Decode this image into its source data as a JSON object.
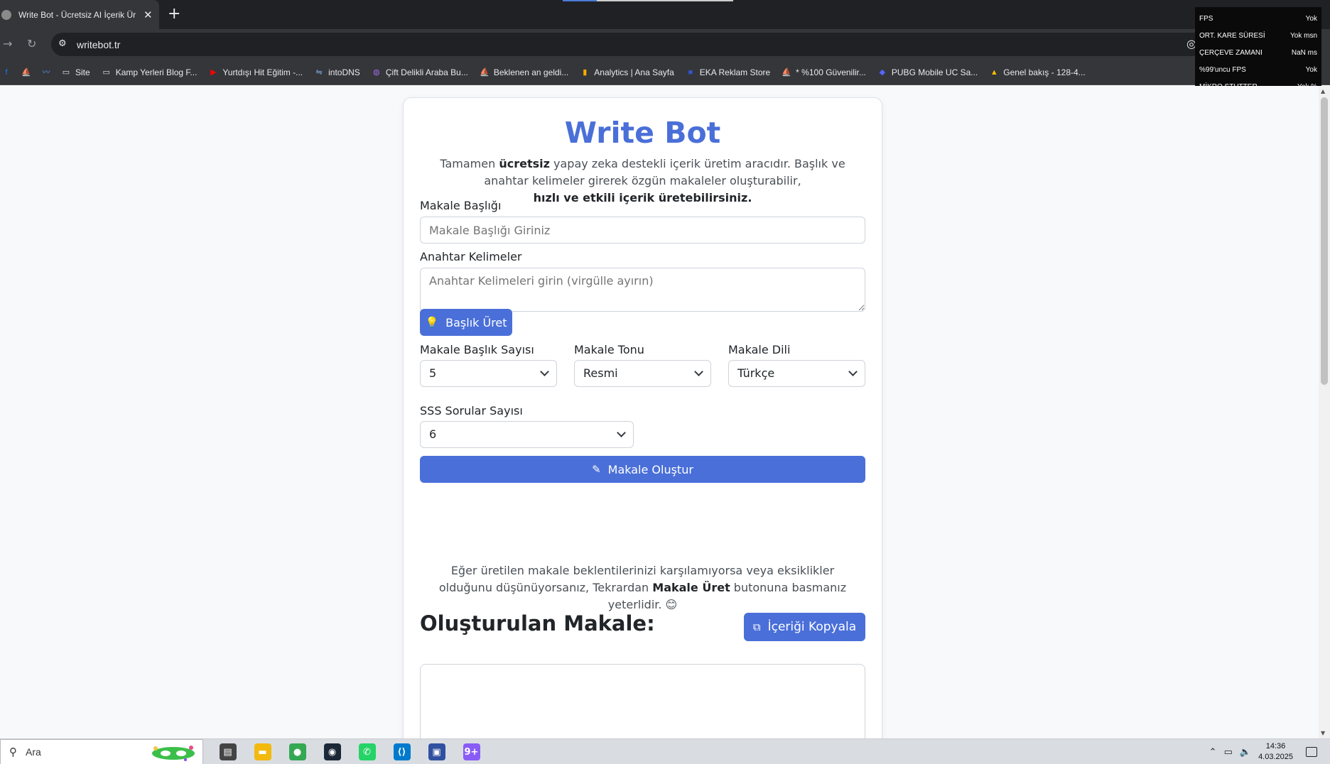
{
  "browser": {
    "tab_title": "Write Bot - Ücretsiz AI İçerik Ür",
    "tab_close": "✕",
    "new_tab": "+",
    "url": "writebot.tr",
    "bookmarks": [
      {
        "label": "",
        "icon": "facebook-icon",
        "color": "#1877f2"
      },
      {
        "label": "",
        "icon": "sailboat-icon",
        "color": "#ffffff"
      },
      {
        "label": "",
        "icon": "trend-icon",
        "color": "#4fa3ff"
      },
      {
        "label": "Site",
        "icon": "folder-icon",
        "color": "#e8eaed"
      },
      {
        "label": "Kamp Yerleri Blog F...",
        "icon": "folder-icon",
        "color": "#e8eaed"
      },
      {
        "label": "Yurtdışı Hit Eğitim -...",
        "icon": "youtube-icon",
        "color": "#ff0000"
      },
      {
        "label": "intoDNS",
        "icon": "dns-icon",
        "color": "#7aa7e0"
      },
      {
        "label": "Çift Delikli Araba Bu...",
        "icon": "purple-globe-icon",
        "color": "#a16ae8"
      },
      {
        "label": "Beklenen an geldi...",
        "icon": "sailboat-icon",
        "color": "#ffffff"
      },
      {
        "label": "Analytics | Ana Sayfa",
        "icon": "analytics-icon",
        "color": "#f9ab00"
      },
      {
        "label": "EKA Reklam Store",
        "icon": "store-icon",
        "color": "#3355cc"
      },
      {
        "label": "* %100 Güvenilir...",
        "icon": "sailboat-icon",
        "color": "#ffffff"
      },
      {
        "label": "PUBG Mobile UC Sa...",
        "icon": "pubg-icon",
        "color": "#5566ff"
      },
      {
        "label": "Genel bakış - 128-4...",
        "icon": "google-ads-icon",
        "color": "#fbbc04"
      }
    ]
  },
  "fps_overlay": [
    {
      "label": "FPS",
      "value": "Yok"
    },
    {
      "label": "ORT. KARE SÜRESİ",
      "value": "Yok msn"
    },
    {
      "label": "ÇERÇEVE ZAMANI",
      "value": "NaN ms"
    },
    {
      "label": "%99'uncu FPS",
      "value": "Yok"
    },
    {
      "label": "MİKRO STUTTER",
      "value": "Yok %"
    }
  ],
  "app": {
    "title": "Write Bot",
    "intro_prefix": "Tamamen ",
    "intro_bold1": "ücretsiz",
    "intro_middle": " yapay zeka destekli içerik üretim aracıdır. Başlık ve anahtar kelimeler girerek özgün makaleler oluşturabilir,",
    "intro_bold2": "hızlı ve etkili içerik üretebilirsiniz.",
    "title_label": "Makale Başlığı",
    "title_placeholder": "Makale Başlığı Giriniz",
    "keywords_label": "Anahtar Kelimeler",
    "keywords_placeholder": "Anahtar Kelimeleri girin (virgülle ayırın)",
    "generate_title_button": "Başlık Üret",
    "count_label": "Makale Başlık Sayısı",
    "count_value": "5",
    "tone_label": "Makale Tonu",
    "tone_value": "Resmi",
    "language_label": "Makale Dili",
    "language_value": "Türkçe",
    "faq_label": "SSS Sorular Sayısı",
    "faq_value": "6",
    "create_button": "Makale Oluştur",
    "note_prefix": "Eğer üretilen makale beklentilerinizi karşılamıyorsa veya eksiklikler olduğunu düşünüyorsanız, Tekrardan ",
    "note_bold": "Makale Üret",
    "note_suffix": " butonuna basmanız yeterlidir. 😊",
    "result_heading": "Oluşturulan Makale:",
    "copy_button": "İçeriği Kopyala"
  },
  "taskbar": {
    "search_text": "Ara",
    "apps": [
      {
        "name": "task-view-icon",
        "color": "#444444",
        "glyph": "▤"
      },
      {
        "name": "file-explorer-icon",
        "color": "#f2b90f",
        "glyph": "▬"
      },
      {
        "name": "chrome-icon",
        "color": "#34a853",
        "glyph": "●"
      },
      {
        "name": "steam-icon",
        "color": "#1b2838",
        "glyph": "◉"
      },
      {
        "name": "whatsapp-icon",
        "color": "#25d366",
        "glyph": "✆"
      },
      {
        "name": "vscode-icon",
        "color": "#007acc",
        "glyph": "⟨⟩"
      },
      {
        "name": "app-icon",
        "color": "#3050a0",
        "glyph": "▣"
      },
      {
        "name": "messenger-icon",
        "color": "#8a5cf6",
        "glyph": "9+"
      }
    ],
    "time": "14:36",
    "date": "4.03.2025"
  }
}
